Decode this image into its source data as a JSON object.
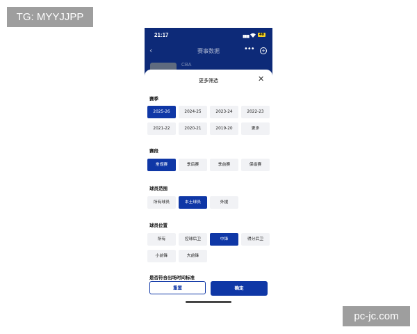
{
  "watermarks": {
    "top_left": "TG: MYYJJPP",
    "bottom_right": "pc-jc.com"
  },
  "status_bar": {
    "time": "21:17",
    "signal": "::",
    "battery": "40"
  },
  "navbar": {
    "back": "‹",
    "title": "赛事数据",
    "more": "•••",
    "add": "+"
  },
  "team": {
    "name": "CBA"
  },
  "sheet": {
    "title": "更多筛选",
    "close": "✕",
    "season": {
      "label": "赛季",
      "options": [
        "2025-26",
        "2024-25",
        "2023-24",
        "2022-23",
        "2021-22",
        "2020-21",
        "2019-20",
        "更多"
      ],
      "selected": "2025-26"
    },
    "stage": {
      "label": "赛段",
      "options": [
        "常规赛",
        "季后赛",
        "季前赛",
        "保级赛"
      ],
      "selected": "常规赛"
    },
    "player_scope": {
      "label": "球员范围",
      "options": [
        "所有球员",
        "本土球员",
        "外援"
      ],
      "selected": "本土球员"
    },
    "position": {
      "label": "球员位置",
      "options": [
        "所有",
        "控球后卫",
        "中锋",
        "得分后卫",
        "小前锋",
        "大前锋"
      ],
      "selected": "中锋"
    },
    "time_standard": {
      "label": "是否符合出场时间标准"
    },
    "reset": "重置",
    "confirm": "确定"
  },
  "colors": {
    "accent": "#0f37a6",
    "header_bg": "#0d2a78",
    "chip_bg": "#f1f2f5"
  }
}
